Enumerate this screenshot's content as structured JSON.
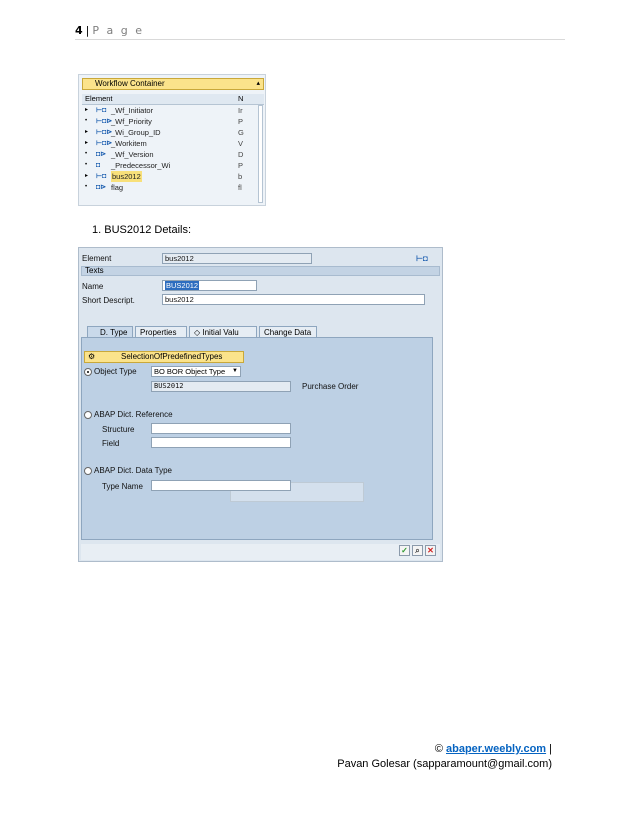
{
  "page": {
    "number": "4",
    "separator": "|",
    "label": "P a g e"
  },
  "workflow": {
    "title": "Workflow Container",
    "col_element": "Element",
    "col_short": "N",
    "rows": [
      {
        "name": "_Wf_Initiator",
        "value": "Ir"
      },
      {
        "name": "_Wf_Priority",
        "value": "P"
      },
      {
        "name": "_Wi_Group_ID",
        "value": "G"
      },
      {
        "name": "_Workitem",
        "value": "V"
      },
      {
        "name": "_Wf_Version",
        "value": "D"
      },
      {
        "name": "_Predecessor_Wi",
        "value": "P"
      },
      {
        "name": "bus2012",
        "value": "b"
      },
      {
        "name": "flag",
        "value": "fl"
      }
    ]
  },
  "caption": "1.  BUS2012 Details:",
  "dialog": {
    "element_label": "Element",
    "element_value": "bus2012",
    "texts_section": "Texts",
    "name_label": "Name",
    "name_value": "BUS2012",
    "short_label": "Short Descript.",
    "short_value": "bus2012",
    "tabs": [
      "D. Type",
      "Properties",
      "Initial Valu",
      "Change Data"
    ],
    "selection_button": "SelectionOfPredefinedTypes",
    "object_type_label": "Object Type",
    "object_type_select": "BO BOR Object Type",
    "object_type_value": "BUS2012",
    "object_type_desc": "Purchase Order",
    "abap_ref_label": "ABAP Dict. Reference",
    "structure_label": "Structure",
    "field_label": "Field",
    "abap_data_label": "ABAP Dict. Data Type",
    "type_name_label": "Type Name"
  },
  "footer": {
    "copyright": "©",
    "link": "abaper.weebly.com",
    "bar": "|",
    "author": "Pavan Golesar (sapparamount@gmail.com)"
  },
  "colors": {
    "link": "#0563c1",
    "highlight": "#fbe38b",
    "panel": "#bdd0e4"
  }
}
